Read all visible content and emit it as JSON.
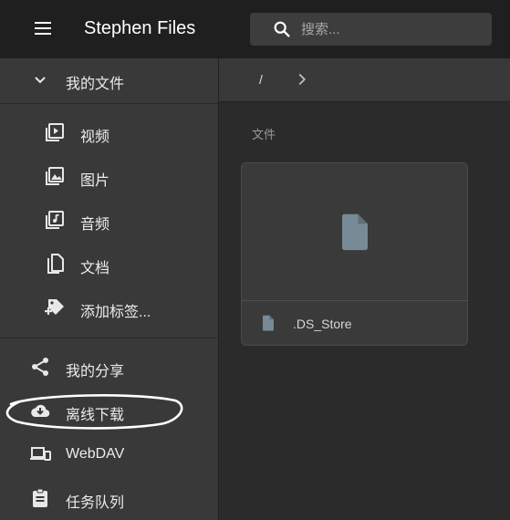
{
  "app": {
    "title": "Stephen Files"
  },
  "search": {
    "placeholder": "搜索..."
  },
  "sidebar": {
    "my_files": "我的文件",
    "categories": [
      {
        "label": "视频",
        "icon": "video-icon"
      },
      {
        "label": "图片",
        "icon": "image-icon"
      },
      {
        "label": "音频",
        "icon": "audio-icon"
      },
      {
        "label": "文档",
        "icon": "document-icon"
      },
      {
        "label": "添加标签...",
        "icon": "add-tag-icon"
      }
    ],
    "items": [
      {
        "label": "我的分享",
        "icon": "share-icon"
      },
      {
        "label": "离线下载",
        "icon": "cloud-download-icon"
      },
      {
        "label": "WebDAV",
        "icon": "devices-icon"
      },
      {
        "label": "任务队列",
        "icon": "clipboard-icon"
      }
    ]
  },
  "breadcrumb": {
    "root": "/"
  },
  "main": {
    "section_label": "文件",
    "files": [
      {
        "name": ".DS_Store"
      }
    ]
  },
  "colors": {
    "appbar": "#1f1f1f",
    "sidebar": "#393939",
    "content": "#2b2b2b",
    "file_icon": "#778a96"
  }
}
